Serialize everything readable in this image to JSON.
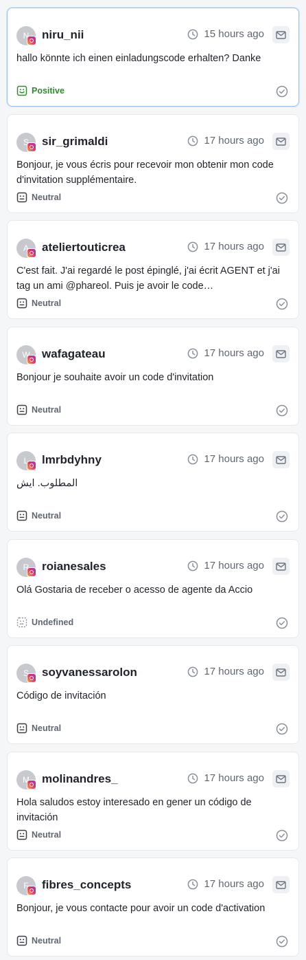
{
  "colors": {
    "positive": "#2f8a2f",
    "neutral": "#5f6670",
    "selected_border": "#9cc3f0",
    "instagram_gradient": [
      "#f9a33f",
      "#e1306c",
      "#a235c8"
    ]
  },
  "icons": {
    "time": "clock-icon",
    "reply": "mail-icon",
    "done": "check-circle-icon",
    "platform": "instagram-icon",
    "positive": "smile-face-icon",
    "neutral": "neutral-face-icon",
    "undefined": "dashed-face-icon"
  },
  "messages": [
    {
      "avatar_initial": "N",
      "username": "niru_nii",
      "time": "15 hours ago",
      "text": "hallo könnte ich einen einladungscode erhalten? Danke",
      "sentiment": "Positive",
      "sentiment_type": "positive",
      "selected": true
    },
    {
      "avatar_initial": "S",
      "username": "sir_grimaldi",
      "time": "17 hours ago",
      "text": "Bonjour, je vous écris pour recevoir mon obtenir mon code d'invitation supplémentaire.",
      "sentiment": "Neutral",
      "sentiment_type": "neutral"
    },
    {
      "avatar_initial": "A",
      "username": "ateliertouticrea",
      "time": "17 hours ago",
      "text": "C'est fait. J'ai regardé le post épinglé, j'ai écrit AGENT et j'ai tag un ami @phareol. Puis je avoir le code…",
      "sentiment": "Neutral",
      "sentiment_type": "neutral"
    },
    {
      "avatar_initial": "W",
      "username": "wafagateau",
      "time": "17 hours ago",
      "text": "Bonjour je souhaite avoir un code d'invitation",
      "sentiment": "Neutral",
      "sentiment_type": "neutral"
    },
    {
      "avatar_initial": "L",
      "username": "lmrbdyhny",
      "time": "17 hours ago",
      "text": "المطلوب. ايش",
      "sentiment": "Neutral",
      "sentiment_type": "neutral",
      "rtl": true
    },
    {
      "avatar_initial": "R",
      "username": "roianesales",
      "time": "17 hours ago",
      "text": "Olá Gostaria de receber o acesso de agente da Accio",
      "sentiment": "Undefined",
      "sentiment_type": "undefined"
    },
    {
      "avatar_initial": "S",
      "username": "soyvanessarolon",
      "time": "17 hours ago",
      "text": "Código de invitación",
      "sentiment": "Neutral",
      "sentiment_type": "neutral"
    },
    {
      "avatar_initial": "M",
      "username": "molinandres_",
      "time": "17 hours ago",
      "text": "Hola saludos estoy interesado en gener un código de invitación",
      "sentiment": "Neutral",
      "sentiment_type": "neutral"
    },
    {
      "avatar_initial": "F",
      "username": "fibres_concepts",
      "time": "17 hours ago",
      "text": "Bonjour, je vous contacte pour avoir un code d'activation",
      "sentiment": "Neutral",
      "sentiment_type": "neutral"
    }
  ]
}
